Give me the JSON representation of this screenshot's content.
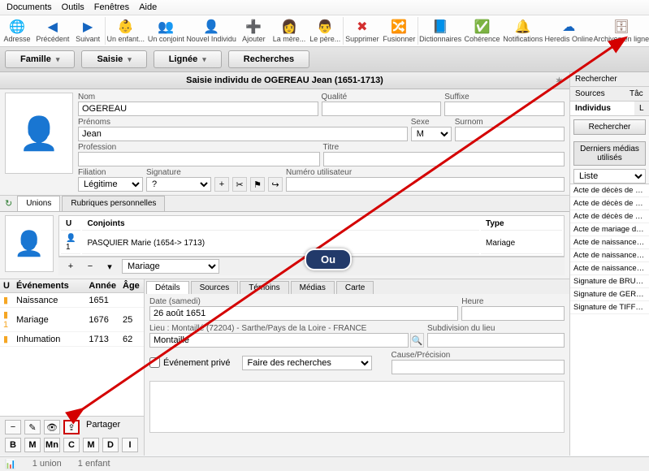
{
  "menus": [
    "Documents",
    "Outils",
    "Fenêtres",
    "Aide"
  ],
  "toolbar": [
    {
      "icon": "🌐",
      "label": "Adresse",
      "color": "#1565c0"
    },
    {
      "icon": "◀",
      "label": "Précédent",
      "color": "#1565c0"
    },
    {
      "icon": "▶",
      "label": "Suivant",
      "color": "#1565c0"
    },
    {
      "icon": "👶",
      "label": "Un enfant...",
      "color": "#f5a623"
    },
    {
      "icon": "👥",
      "label": "Un conjoint",
      "color": "#f5a623"
    },
    {
      "icon": "👤",
      "label": "Nouvel Individu",
      "color": "#f5a623"
    },
    {
      "icon": "➕",
      "label": "Ajouter",
      "color": "#2e7d32"
    },
    {
      "icon": "👩",
      "label": "La mère...",
      "color": "#e91e63"
    },
    {
      "icon": "👨",
      "label": "Le père...",
      "color": "#1565c0"
    },
    {
      "icon": "✖",
      "label": "Supprimer",
      "color": "#d32f2f"
    },
    {
      "icon": "🔀",
      "label": "Fusionner",
      "color": "#607d8b"
    },
    {
      "icon": "📘",
      "label": "Dictionnaires",
      "color": "#1565c0"
    },
    {
      "icon": "✅",
      "label": "Cohérence",
      "color": "#2e7d32"
    },
    {
      "icon": "🔔",
      "label": "Notifications",
      "color": "#9c27b0"
    },
    {
      "icon": "☁",
      "label": "Heredis Online",
      "color": "#1565c0"
    },
    {
      "icon": "🗄",
      "label": "Archives en ligne",
      "color": "#8d6e63"
    }
  ],
  "tabs": {
    "t1": "Famille",
    "t2": "Saisie",
    "t3": "Lignée",
    "t4": "Recherches"
  },
  "title": "Saisie individu de OGEREAU Jean (1651-1713)",
  "labels": {
    "nom": "Nom",
    "qualite": "Qualité",
    "suffixe": "Suffixe",
    "prenoms": "Prénoms",
    "sexe": "Sexe",
    "surnom": "Surnom",
    "profession": "Profession",
    "titre": "Titre",
    "filiation": "Filiation",
    "signature": "Signature",
    "numutil": "Numéro utilisateur",
    "unions": "Unions",
    "rubperso": "Rubriques personnelles",
    "u": "U",
    "conjoints": "Conjoints",
    "type": "Type",
    "evenements": "Événements",
    "annee": "Année",
    "age": "Âge",
    "details": "Détails",
    "sources": "Sources",
    "temoins": "Témoins",
    "medias": "Médias",
    "carte": "Carte",
    "date": "Date (samedi)",
    "heure": "Heure",
    "lieu": "Lieu : Montaillé (72204) - Sarthe/Pays de la Loire - FRANCE",
    "subdiv": "Subdivision du lieu",
    "eventprive": "Événement privé",
    "faire": "Faire des recherches",
    "cause": "Cause/Précision",
    "partager": "Partager",
    "rechercher": "Rechercher",
    "recentmedias": "Derniers médias utilisés",
    "liste": "Liste",
    "individus": "Individus",
    "tac": "Tâc",
    "sourcesr": "Sources"
  },
  "values": {
    "nom": "OGEREAU",
    "prenoms": "Jean",
    "sexe": "M",
    "filiation": "Légitime",
    "signature": "?",
    "conjoint": "PASQUIER Marie (1654-> 1713)",
    "utype": "Mariage",
    "mariage_sel": "Mariage",
    "date": "26 août 1651",
    "lieu": "Montaillé"
  },
  "events": [
    {
      "name": "Naissance",
      "year": "1651",
      "age": ""
    },
    {
      "name": "Mariage",
      "year": "1676",
      "age": "25"
    },
    {
      "name": "Inhumation",
      "year": "1713",
      "age": "62"
    }
  ],
  "recent": [
    "Acte de décès de BUR",
    "Acte de décès de OG",
    "Acte de décès de TFF",
    "Acte de mariage de O",
    "Acte de naissance de",
    "Acte de naissance de",
    "Acte de naissance de",
    "Signature de BRUNET",
    "Signature de GERMAI",
    "Signature de TIFFON L"
  ],
  "footer": {
    "letters": [
      "B",
      "M",
      "Mn",
      "C",
      "M",
      "D",
      "I"
    ]
  },
  "annotation": {
    "ou": "Ou"
  },
  "status": {
    "union": "1 union",
    "enfant": "1 enfant"
  }
}
